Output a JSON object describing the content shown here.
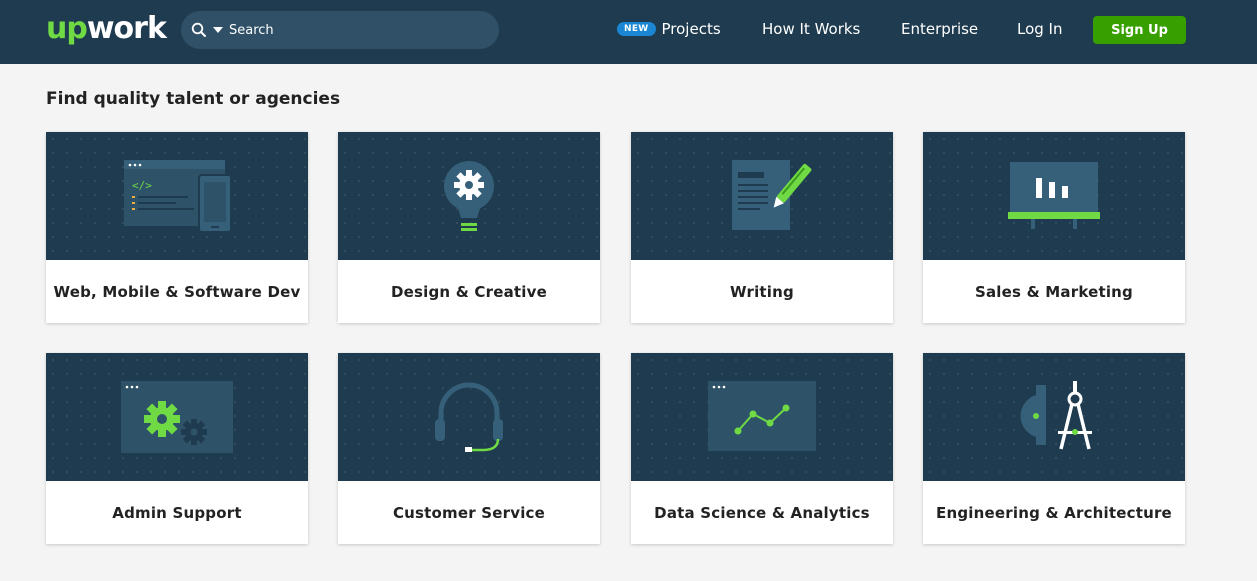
{
  "header": {
    "logo_up": "up",
    "logo_work": "work",
    "search": {
      "placeholder": "Search"
    },
    "nav": {
      "badge": "NEW",
      "projects": "Projects",
      "how_it_works": "How It Works",
      "enterprise": "Enterprise",
      "login": "Log In",
      "signup": "Sign Up"
    }
  },
  "main": {
    "title": "Find quality talent or agencies",
    "categories": [
      {
        "label": "Web, Mobile & Software Dev",
        "icon": "code-window-icon"
      },
      {
        "label": "Design & Creative",
        "icon": "lightbulb-gear-icon"
      },
      {
        "label": "Writing",
        "icon": "document-pen-icon"
      },
      {
        "label": "Sales & Marketing",
        "icon": "presentation-board-icon"
      },
      {
        "label": "Admin Support",
        "icon": "gears-window-icon"
      },
      {
        "label": "Customer Service",
        "icon": "headset-icon"
      },
      {
        "label": "Data Science & Analytics",
        "icon": "line-chart-window-icon"
      },
      {
        "label": "Engineering & Architecture",
        "icon": "compass-protractor-icon"
      }
    ]
  },
  "colors": {
    "header_bg": "#1f3b4f",
    "accent_green": "#6fda44",
    "signup_green": "#37a000",
    "badge_blue": "#1a86d4"
  }
}
